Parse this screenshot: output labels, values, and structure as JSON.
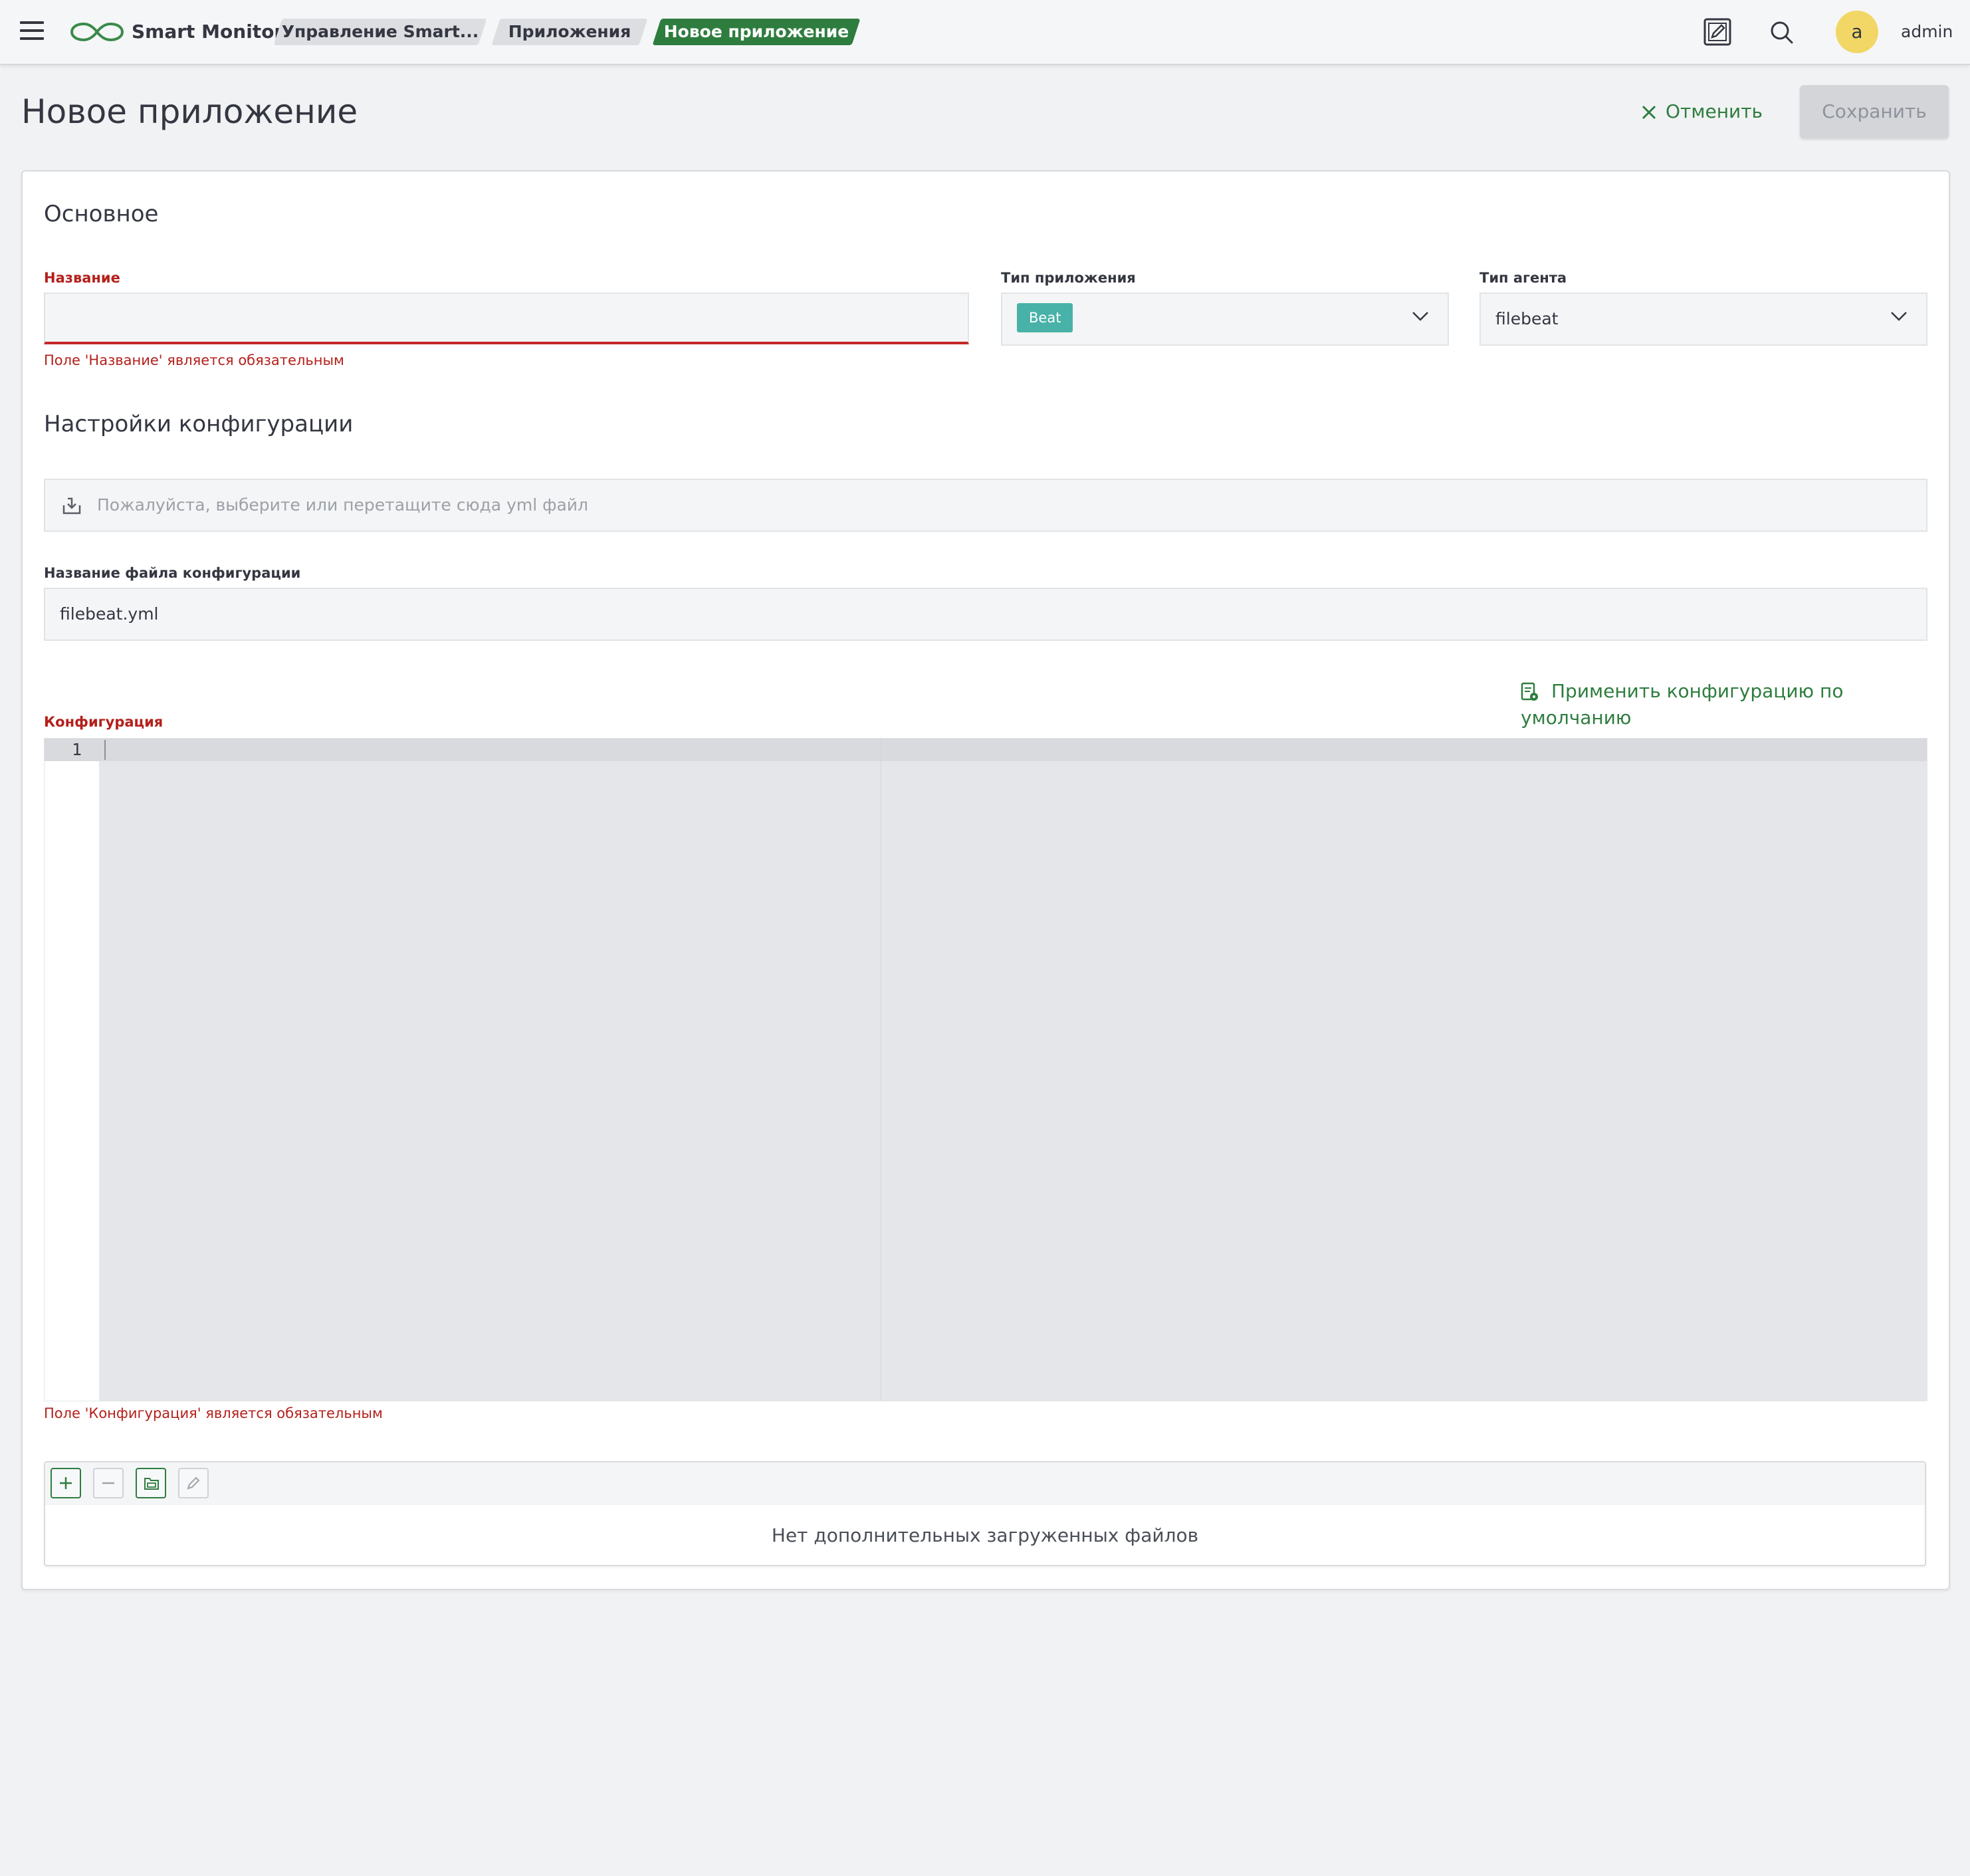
{
  "app": {
    "brand": "Smart Monitor"
  },
  "breadcrumbs": [
    {
      "label": "Управление Smart..."
    },
    {
      "label": "Приложения"
    },
    {
      "label": "Новое приложение"
    }
  ],
  "user": {
    "avatar_letter": "a",
    "name": "admin"
  },
  "page": {
    "title": "Новое приложение",
    "cancel_label": "Отменить",
    "save_label": "Сохранить"
  },
  "basic": {
    "section_title": "Основное",
    "name": {
      "label": "Название",
      "value": "",
      "error": "Поле 'Название' является обязательным"
    },
    "app_type": {
      "label": "Тип приложения",
      "value": "Beat"
    },
    "agent_type": {
      "label": "Тип агента",
      "value": "filebeat"
    }
  },
  "config": {
    "section_title": "Настройки конфигурации",
    "upload_placeholder": "Пожалуйста, выберите или перетащите сюда yml файл",
    "filename": {
      "label": "Название файла конфигурации",
      "value": "filebeat.yml"
    },
    "apply_default_label": "Применить конфигурацию по умолчанию",
    "editor": {
      "label": "Конфигурация",
      "line_number": "1",
      "error": "Поле 'Конфигурация' является обязательным"
    }
  },
  "files": {
    "empty_text": "Нет дополнительных загруженных файлов"
  },
  "colors": {
    "accent": "#2e7d3f",
    "error": "#b4201b",
    "badge": "#48b2a8",
    "avatar": "#f2d766"
  }
}
